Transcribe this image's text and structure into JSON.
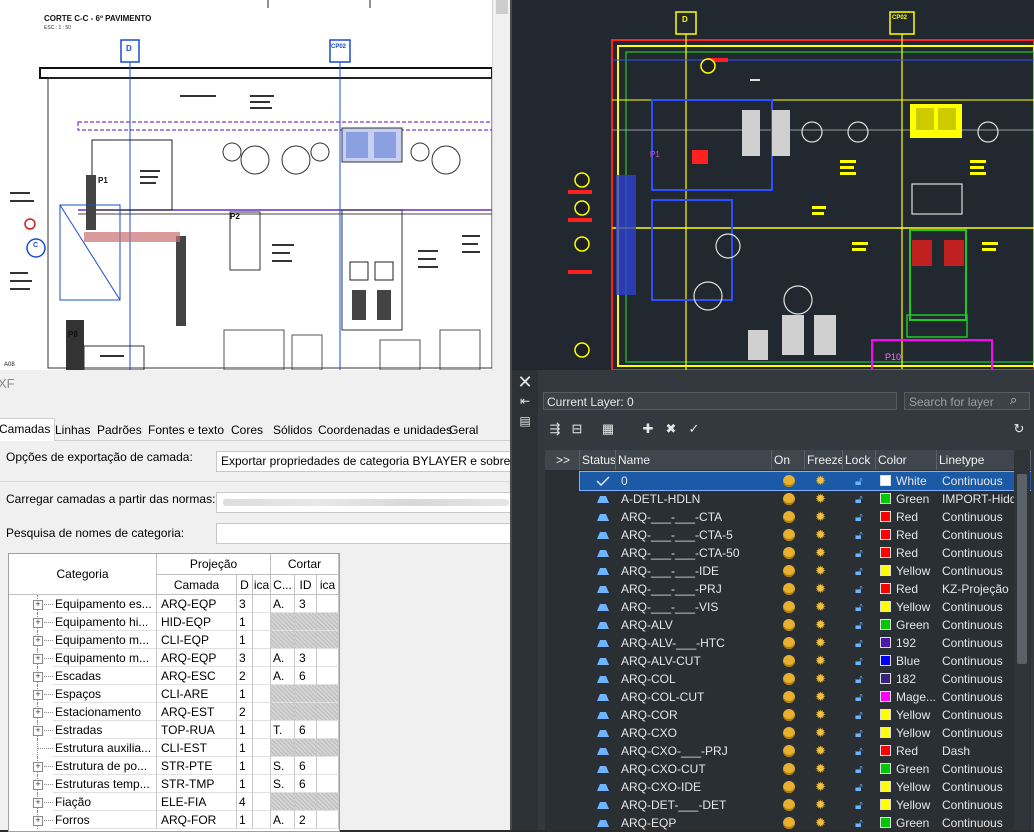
{
  "drawing_left": {
    "title": "CORTE C-C - 6º PAVIMENTO",
    "scale": "ESC.: 1 : 50",
    "labels": [
      "D",
      "CP02",
      "C",
      "P1",
      "P2",
      "P8",
      "A08"
    ]
  },
  "drawing_right": {
    "labels": [
      "D",
      "CP02",
      "P1",
      "P10"
    ]
  },
  "dialog": {
    "title": "XF",
    "tabs": [
      "Camadas",
      "Linhas",
      "Padrões",
      "Fontes e texto",
      "Cores",
      "Sólidos",
      "Coordenadas e unidades",
      "Geral"
    ],
    "export_label": "Opções de exportação de camada:",
    "export_value": "Exportar propriedades de categoria BYLAYER e sobrepor BYENTITY",
    "load_label": "Carregar camadas a partir das normas:",
    "search_label": "Pesquisa de nomes de categoria:",
    "grid": {
      "head_categoria": "Categoria",
      "head_projecao": "Projeção",
      "head_cortar": "Cortar",
      "sub_camada": "Camada",
      "sub_id1": "D",
      "sub_cor1": "ica",
      "sub_camada2": "C...",
      "sub_id2": "ID",
      "sub_cor2": "ica",
      "rows": [
        {
          "cat": "Equipamento es...",
          "layer": "ARQ-EQP",
          "id": "3",
          "cut": "A.",
          "cid": "3",
          "hatch": false,
          "tree": "plus"
        },
        {
          "cat": "Equipamento hi...",
          "layer": "HID-EQP",
          "id": "1",
          "cut": "",
          "cid": "",
          "hatch": true,
          "tree": "plus"
        },
        {
          "cat": "Equipamento m...",
          "layer": "CLI-EQP",
          "id": "1",
          "cut": "",
          "cid": "",
          "hatch": true,
          "tree": "plus"
        },
        {
          "cat": "Equipamento m...",
          "layer": "ARQ-EQP",
          "id": "3",
          "cut": "A.",
          "cid": "3",
          "hatch": false,
          "tree": "plus"
        },
        {
          "cat": "Escadas",
          "layer": "ARQ-ESC",
          "id": "2",
          "cut": "A.",
          "cid": "6",
          "hatch": false,
          "tree": "plus"
        },
        {
          "cat": "Espaços",
          "layer": "CLI-ARE",
          "id": "1",
          "cut": "",
          "cid": "",
          "hatch": true,
          "tree": "plus"
        },
        {
          "cat": "Estacionamento",
          "layer": "ARQ-EST",
          "id": "2",
          "cut": "",
          "cid": "",
          "hatch": true,
          "tree": "plus"
        },
        {
          "cat": "Estradas",
          "layer": "TOP-RUA",
          "id": "1",
          "cut": "T.",
          "cid": "6",
          "hatch": false,
          "tree": "plus"
        },
        {
          "cat": "Estrutura auxilia...",
          "layer": "CLI-EST",
          "id": "1",
          "cut": "",
          "cid": "",
          "hatch": true,
          "tree": "line"
        },
        {
          "cat": "Estrutura de po...",
          "layer": "STR-PTE",
          "id": "1",
          "cut": "S.",
          "cid": "6",
          "hatch": false,
          "tree": "plus"
        },
        {
          "cat": "Estruturas temp...",
          "layer": "STR-TMP",
          "id": "1",
          "cut": "S.",
          "cid": "6",
          "hatch": false,
          "tree": "plus"
        },
        {
          "cat": "Fiação",
          "layer": "ELE-FIA",
          "id": "4",
          "cut": "",
          "cid": "",
          "hatch": true,
          "tree": "plus"
        },
        {
          "cat": "Forros",
          "layer": "ARQ-FOR",
          "id": "1",
          "cut": "A.",
          "cid": "2",
          "hatch": false,
          "tree": "plus"
        }
      ]
    }
  },
  "layer_manager": {
    "current_layer": "Current Layer: 0",
    "search_placeholder": "Search for layer",
    "expand_label": ">>",
    "columns": {
      "status": "Status",
      "name": "Name",
      "on": "On",
      "freeze": "Freeze",
      "lock": "Lock",
      "color": "Color",
      "linetype": "Linetype"
    },
    "layers": [
      {
        "name": "0",
        "color": "White",
        "hex": "#ffffff",
        "ltype": "Continuous",
        "current": true
      },
      {
        "name": "A-DETL-HDLN",
        "color": "Green",
        "hex": "#00c800",
        "ltype": "IMPORT-Hidden"
      },
      {
        "name": "ARQ-___-___-CTA",
        "color": "Red",
        "hex": "#ff0000",
        "ltype": "Continuous"
      },
      {
        "name": "ARQ-___-___-CTA-5",
        "color": "Red",
        "hex": "#ff0000",
        "ltype": "Continuous"
      },
      {
        "name": "ARQ-___-___-CTA-50",
        "color": "Red",
        "hex": "#ff0000",
        "ltype": "Continuous"
      },
      {
        "name": "ARQ-___-___-IDE",
        "color": "Yellow",
        "hex": "#ffff00",
        "ltype": "Continuous"
      },
      {
        "name": "ARQ-___-___-PRJ",
        "color": "Red",
        "hex": "#ff0000",
        "ltype": "KZ-Projeção"
      },
      {
        "name": "ARQ-___-___-VIS",
        "color": "Yellow",
        "hex": "#ffff00",
        "ltype": "Continuous"
      },
      {
        "name": "ARQ-ALV",
        "color": "Green",
        "hex": "#00c800",
        "ltype": "Continuous"
      },
      {
        "name": "ARQ-ALV-___-HTC",
        "color": "192",
        "hex": "#4c1aa8",
        "ltype": "Continuous"
      },
      {
        "name": "ARQ-ALV-CUT",
        "color": "Blue",
        "hex": "#0000ff",
        "ltype": "Continuous"
      },
      {
        "name": "ARQ-COL",
        "color": "182",
        "hex": "#34247a",
        "ltype": "Continuous"
      },
      {
        "name": "ARQ-COL-CUT",
        "color": "Mage...",
        "hex": "#ff00ff",
        "ltype": "Continuous"
      },
      {
        "name": "ARQ-COR",
        "color": "Yellow",
        "hex": "#ffff00",
        "ltype": "Continuous"
      },
      {
        "name": "ARQ-CXO",
        "color": "Yellow",
        "hex": "#ffff00",
        "ltype": "Continuous"
      },
      {
        "name": "ARQ-CXO-___-PRJ",
        "color": "Red",
        "hex": "#ff0000",
        "ltype": "Dash"
      },
      {
        "name": "ARQ-CXO-CUT",
        "color": "Green",
        "hex": "#00c800",
        "ltype": "Continuous"
      },
      {
        "name": "ARQ-CXO-IDE",
        "color": "Yellow",
        "hex": "#ffff00",
        "ltype": "Continuous"
      },
      {
        "name": "ARQ-DET-___-DET",
        "color": "Yellow",
        "hex": "#ffff00",
        "ltype": "Continuous"
      },
      {
        "name": "ARQ-EQP",
        "color": "Green",
        "hex": "#00c800",
        "ltype": "Continuous"
      }
    ]
  }
}
